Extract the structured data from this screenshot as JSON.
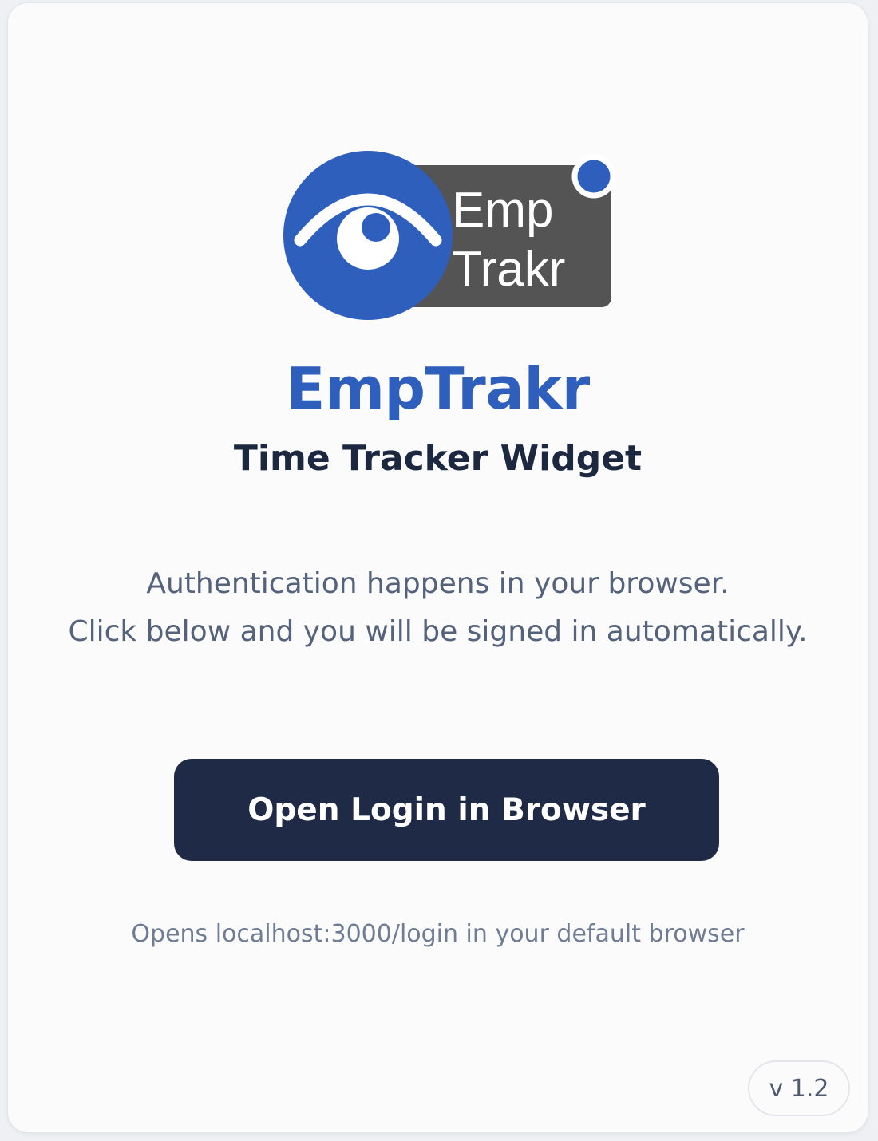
{
  "logo": {
    "line1": "Emp",
    "line2": "Trakr",
    "colors": {
      "blue": "#2e5fbd",
      "box": "#545454",
      "white": "#ffffff"
    }
  },
  "brand": {
    "name": "EmpTrakr",
    "subtitle": "Time Tracker Widget"
  },
  "description": {
    "line1": "Authentication happens in your browser.",
    "line2": "Click below and you will be signed in automatically."
  },
  "login_button": {
    "label": "Open Login in Browser"
  },
  "hint": "Opens localhost:3000/login in your default browser",
  "version": "v 1.2",
  "colors": {
    "brand_blue": "#2e5fbd",
    "button_bg": "#1f2b46",
    "heading": "#1c2840",
    "body_text": "#54627b",
    "hint_text": "#6f7c93"
  }
}
